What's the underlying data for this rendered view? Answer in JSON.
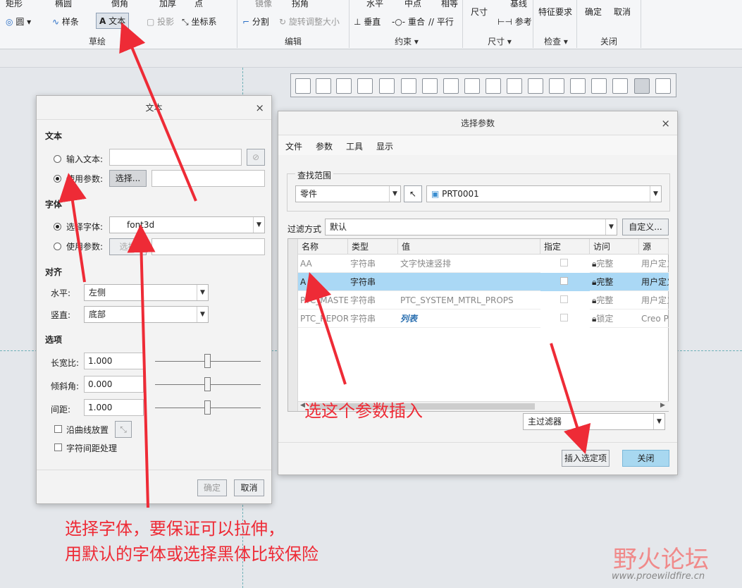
{
  "ribbon": {
    "row1": [
      "矩形",
      "椭圆",
      "倒角",
      "加厚",
      "点",
      "镜像",
      "拐角",
      "水平",
      "中点",
      "相等",
      "基线"
    ],
    "row2": [
      "圆",
      "样条",
      "文本",
      "投影",
      "坐标系",
      "分割",
      "旋转调整大小",
      "垂直",
      "重合",
      "平行",
      "参考"
    ],
    "size_label": "尺寸",
    "feature_req": "特征要求",
    "ok": "确定",
    "cancel": "取消",
    "groups": [
      "草绘",
      "编辑",
      "约束 ▾",
      "尺寸 ▾",
      "检查 ▾",
      "关闭"
    ]
  },
  "text_dialog": {
    "title": "文本",
    "sec_text": "文本",
    "input_text_label": "输入文本:",
    "use_param_label": "使用参数:",
    "select_btn": "选择...",
    "sec_font": "字体",
    "select_font_label": "选择字体:",
    "font_value": "font3d",
    "use_param2_label": "使用参数:",
    "select_btn2": "选择",
    "sec_align": "对齐",
    "horizontal_label": "水平:",
    "horizontal_value": "左侧",
    "vertical_label": "竖直:",
    "vertical_value": "底部",
    "sec_options": "选项",
    "aspect_label": "长宽比:",
    "aspect_value": "1.000",
    "slant_label": "倾斜角:",
    "slant_value": "0.000",
    "spacing_label": "间距:",
    "spacing_value": "1.000",
    "along_curve": "沿曲线放置",
    "kerning": "字符间距处理",
    "ok": "确定",
    "cancel": "取消"
  },
  "param_dialog": {
    "title": "选择参数",
    "menu": [
      "文件",
      "参数",
      "工具",
      "显示"
    ],
    "scope_label": "查找范围",
    "scope_value": "零件",
    "model_value": "PRT0001",
    "filter_label": "过滤方式",
    "filter_value": "默认",
    "custom_btn": "自定义...",
    "columns": [
      "名称",
      "类型",
      "值",
      "指定",
      "访问",
      "源"
    ],
    "rows": [
      {
        "name": "AA",
        "type": "字符串",
        "value": "文字快速竖排",
        "access": "完整",
        "source": "用户定义"
      },
      {
        "name": "A",
        "type": "字符串",
        "value": "",
        "access": "完整",
        "source": "用户定义"
      },
      {
        "name": "PTC_MASTER",
        "type": "字符串",
        "value": "PTC_SYSTEM_MTRL_PROPS",
        "access": "完整",
        "source": "用户定义"
      },
      {
        "name": "PTC_REPORT",
        "type": "字符串",
        "value": "列表",
        "access": "锁定",
        "source": "Creo P"
      }
    ],
    "main_filter": "主过滤器",
    "insert_btn": "插入选定项",
    "close_btn": "关闭"
  },
  "annotations": {
    "insert_tip": "选这个参数插入",
    "font_tip_1": "选择字体，要保证可以拉伸，",
    "font_tip_2": "用默认的字体或选择黑体比较保险"
  },
  "watermark": {
    "cn": "野火论坛",
    "url": "www.proewildfire.cn"
  },
  "colors": {
    "annotation": "#ee2b36",
    "selected_row": "#aad8f5",
    "close_btn": "#a8d8f0"
  }
}
